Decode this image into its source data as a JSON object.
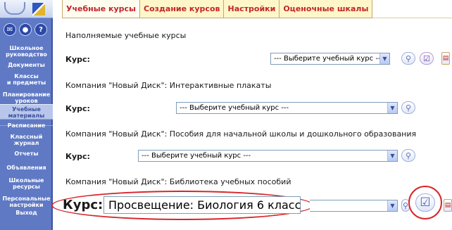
{
  "sidebar": {
    "icons": [
      "mail-icon",
      "users-icon",
      "help-icon"
    ],
    "help_glyph": "?",
    "items": [
      {
        "label": "Школьное руководство",
        "lines": [
          "Школьное",
          "руководство"
        ]
      },
      {
        "label": "Документы",
        "lines": [
          "Документы"
        ]
      },
      {
        "label": "Классы и предметы",
        "lines": [
          "Классы",
          "и предметы"
        ]
      },
      {
        "label": "Планирование уроков",
        "lines": [
          "Планирование",
          "уроков"
        ]
      },
      {
        "label": "Учебные материалы",
        "lines": [
          "Учебные",
          "материалы"
        ],
        "active": true
      },
      {
        "label": "Расписание",
        "lines": [
          "Расписание"
        ]
      },
      {
        "label": "Классный журнал",
        "lines": [
          "Классный",
          "журнал"
        ]
      },
      {
        "label": "Отчеты",
        "lines": [
          "Отчеты"
        ]
      },
      {
        "label": "Объявления",
        "lines": [
          "Объявления"
        ]
      },
      {
        "label": "Школьные ресурсы",
        "lines": [
          "Школьные",
          "ресурсы"
        ]
      },
      {
        "label": "Персональные настройки",
        "lines": [
          "Персональные",
          "настройки"
        ]
      },
      {
        "label": "Выход",
        "lines": [
          "Выход"
        ]
      }
    ]
  },
  "tabs": [
    {
      "label": "Учебные курсы",
      "active": true
    },
    {
      "label": "Создание курсов"
    },
    {
      "label": "Настройки"
    },
    {
      "label": "Оценочные шкалы"
    }
  ],
  "sections": [
    {
      "title": "Наполняемые учебные курсы",
      "course_label": "Курс:",
      "select_value": "--- Выберите учебный курс ---",
      "has_check": true,
      "has_doc": true
    },
    {
      "title": "Компания \"Новый Диск\": Интерактивные плакаты",
      "course_label": "Курс:",
      "select_value": "--- Выберите учебный курс ---"
    },
    {
      "title": "Компания \"Новый Диск\": Пособия для начальной школы и дошкольного образования",
      "course_label": "Курс:",
      "select_value": "--- Выберите учебный курс ---"
    },
    {
      "title": "Компания \"Новый Диск\": Библиотека учебных пособий",
      "course_label": "Курс:",
      "select_value": "Просвещение: Биология 6 класс",
      "has_check": true,
      "has_doc": true
    }
  ],
  "colors": {
    "sidebar_bg": "#5f79c4",
    "tab_text": "#c2262a",
    "highlight": "#d7262a"
  }
}
